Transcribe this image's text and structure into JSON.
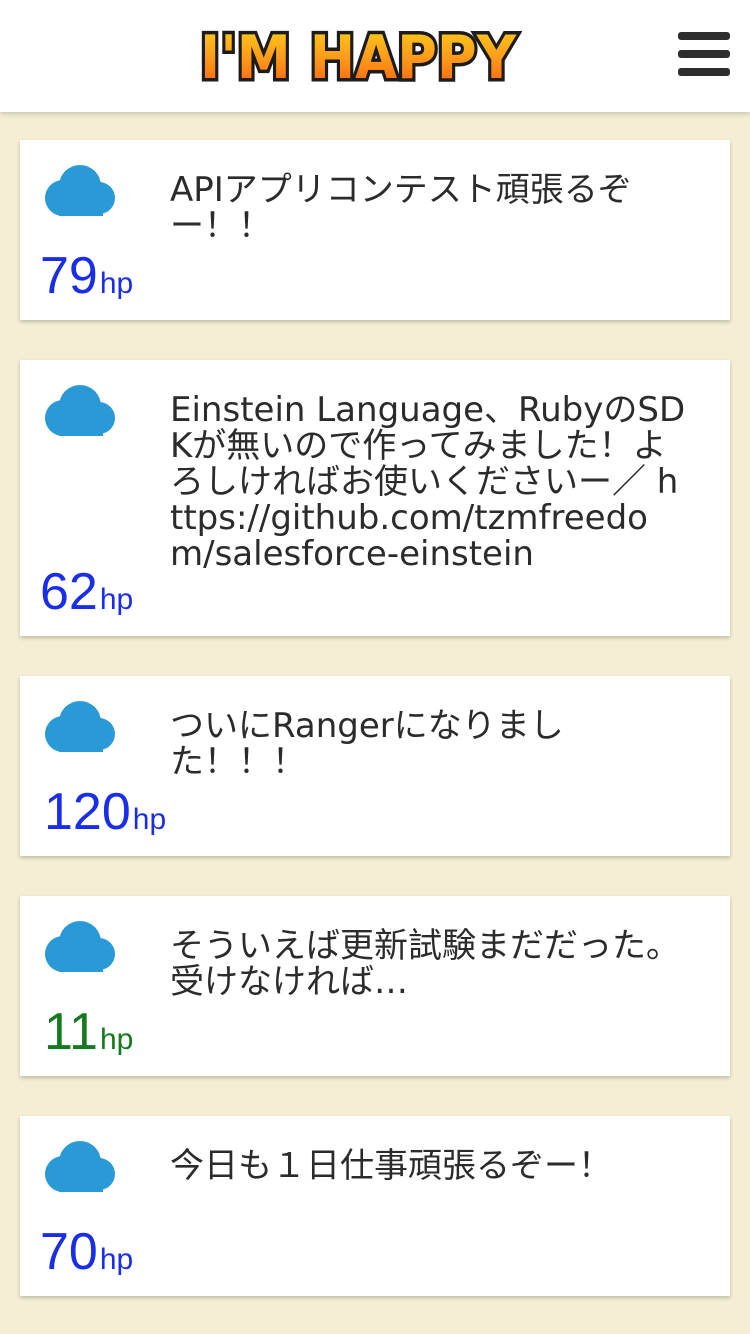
{
  "header": {
    "logo_text": "I'M HAPPY",
    "menu_icon": "hamburger-menu-icon"
  },
  "colors": {
    "background": "#f4eed4",
    "card": "#ffffff",
    "cloud": "#2a9ad6",
    "hp_high": "#1a2ee8",
    "hp_low": "#157a1e",
    "text": "#2b2b2b"
  },
  "posts": [
    {
      "text": "APIアプリコンテスト頑張るぞー！！",
      "hp": "79",
      "hp_unit": "hp",
      "status": "high",
      "icon": "cloud-icon"
    },
    {
      "text": "Einstein Language、RubyのSDKが無いので作ってみました！よろしければお使いくださいー／ https://github.com/tzmfreedom/salesforce-einstein",
      "hp": "62",
      "hp_unit": "hp",
      "status": "high",
      "icon": "cloud-icon"
    },
    {
      "text": "ついにRangerになりました！！！",
      "hp": "120",
      "hp_unit": "hp",
      "status": "high",
      "icon": "cloud-icon"
    },
    {
      "text": "そういえば更新試験まだだった。受けなければ…",
      "hp": "11",
      "hp_unit": "hp",
      "status": "low",
      "icon": "cloud-icon"
    },
    {
      "text": "今日も１日仕事頑張るぞー！",
      "hp": "70",
      "hp_unit": "hp",
      "status": "high",
      "icon": "cloud-icon"
    }
  ]
}
